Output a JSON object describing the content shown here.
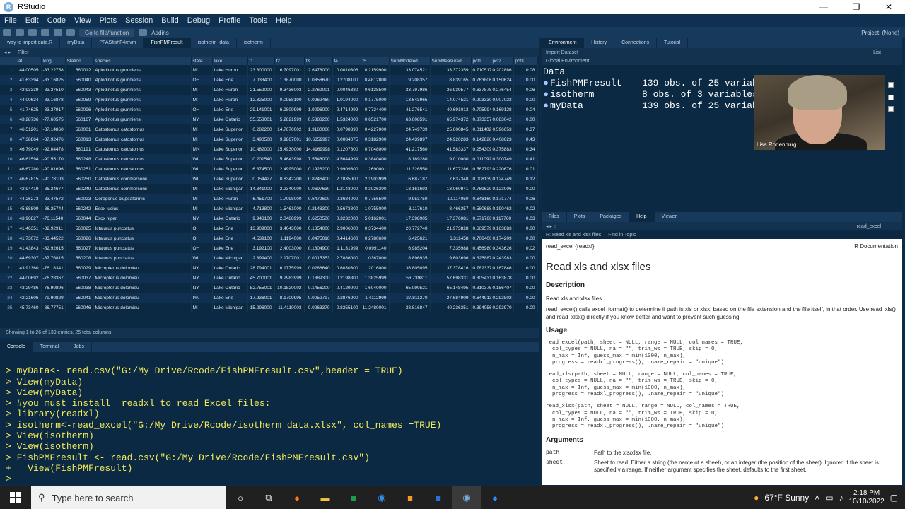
{
  "window": {
    "title": "RStudio",
    "min": "—",
    "max": "❐",
    "close": "✕"
  },
  "menu": [
    "File",
    "Edit",
    "Code",
    "View",
    "Plots",
    "Session",
    "Build",
    "Debug",
    "Profile",
    "Tools",
    "Help"
  ],
  "toolbar": {
    "goto": "Go to file/function",
    "addins": "Addins",
    "project": "Project: (None)"
  },
  "source_tabs": [
    "way to import data.R",
    "myData",
    "PFASfishF4mvm",
    "FishPMFresult",
    "isotherm_data",
    "isotherm"
  ],
  "source_active_tab": "FishPMFresult",
  "filter_label": "Filter",
  "columns": [
    "",
    "lat",
    "long",
    "Station",
    "species",
    "state",
    "lake",
    "f1",
    "f2",
    "f3",
    "f4",
    "f5",
    "SumModeled",
    "SumMeasured",
    "pct1",
    "pct2",
    "pct3"
  ],
  "rows": [
    [
      "1",
      "44.00505",
      "-83.22758",
      "560012",
      "Aplodinotus grunniens",
      "MI",
      "Lake Huron",
      "23.300000",
      "6.7097001",
      "2.6478000",
      "0.0010306",
      "0.2159900",
      "33.074521",
      "33.372359",
      "0.710517",
      "0.202866",
      "0.08"
    ],
    [
      "2",
      "41.63394",
      "-83.16825",
      "560040",
      "Aplodinotus grunniens",
      "OH",
      "Lake Erie",
      "7.033400",
      "1.3870000",
      "0.0358670",
      "0.2708100",
      "0.4812800",
      "9.208357",
      "8.839165",
      "0.763806",
      "0.150624",
      "0.00"
    ],
    [
      "3",
      "43.93339",
      "-83.37510",
      "560043",
      "Aplodinotus grunniens",
      "MI",
      "Lake Huron",
      "21.559000",
      "9.3436003",
      "2.2769001",
      "0.0046380",
      "0.6138500",
      "33.797986",
      "36.939577",
      "0.637878",
      "0.276454",
      "0.06"
    ],
    [
      "4",
      "44.00634",
      "-83.16878",
      "560059",
      "Aplodinotus grunniens",
      "MI",
      "Lake Huron",
      "12.325000",
      "0.0958190",
      "0.0262460",
      "1.0194000",
      "0.1775000",
      "13.643965",
      "14.074521",
      "0.903330",
      "0.007023",
      "0.00"
    ],
    [
      "5",
      "41.74625",
      "-83.37917",
      "560096",
      "Aplodinotus grunniens",
      "OH",
      "Lake Erie",
      "29.141001",
      "6.9809999",
      "1.9096000",
      "2.4714999",
      "0.7734400",
      "41.276541",
      "40.691013",
      "0.705994",
      "0.169128",
      "0.04"
    ],
    [
      "6",
      "43.28736",
      "-77.60575",
      "560167",
      "Aplodinotus grunniens",
      "NY",
      "Lake Ontario",
      "55.553001",
      "5.2821999",
      "0.5888200",
      "1.5324000",
      "0.6521700",
      "63.608591",
      "65.974372",
      "0.873357",
      "0.083042",
      "0.00"
    ],
    [
      "7",
      "46.51201",
      "-87.14860",
      "560001",
      "Catostomus catostomus",
      "MI",
      "Lake Superior",
      "0.282200",
      "14.7670002",
      "1.9180000",
      "0.0798390",
      "0.4227000",
      "24.749739",
      "25.600845",
      "0.011402",
      "0.596653",
      "0.37"
    ],
    [
      "8",
      "47.38864",
      "-87.92476",
      "560013",
      "Catostomus catostomus",
      "MI",
      "Lake Superior",
      "3.490500",
      "9.9867001",
      "10.6359997",
      "0.0084075",
      "0.3182900",
      "24.439897",
      "24.920283",
      "0.142820",
      "0.408623",
      "0.43"
    ],
    [
      "9",
      "46.79049",
      "-92.04478",
      "560191",
      "Catostomus catostomus",
      "MN",
      "Lake Superior",
      "10.482000",
      "15.4930000",
      "14.4169998",
      "0.1207600",
      "0.7048000",
      "41.217560",
      "41.583337",
      "0.254309",
      "0.375883",
      "0.34"
    ],
    [
      "10",
      "46.61594",
      "-90.55170",
      "560248",
      "Catostomus catostomus",
      "WI",
      "Lake Superior",
      "0.201540",
      "5.4643998",
      "7.5548000",
      "4.5644999",
      "0.3840400",
      "18.169280",
      "19.010000",
      "0.011092",
      "0.300749",
      "0.41"
    ],
    [
      "11",
      "46.67280",
      "-90.81696",
      "560251",
      "Catostomus catostomus",
      "WI",
      "Lake Superior",
      "6.374500",
      "2.4995000",
      "0.1926200",
      "0.9909300",
      "1.2690001",
      "11.326550",
      "11.677286",
      "0.562793",
      "0.220676",
      "0.01"
    ],
    [
      "12",
      "46.67815",
      "-90.78103",
      "560250",
      "Catostomus commersonii",
      "WI",
      "Lake Superior",
      "0.054427",
      "0.8342200",
      "0.8246400",
      "2.7835000",
      "2.1903999",
      "6.687187",
      "7.637348",
      "0.008139",
      "0.124749",
      "0.12"
    ],
    [
      "13",
      "42.94419",
      "-86.24677",
      "560249",
      "Catostomus commersonii",
      "MI",
      "Lake Michigan",
      "14.341000",
      "2.2340000",
      "0.0697630",
      "1.2143000",
      "0.3026300",
      "18.161693",
      "18.060941",
      "0.789629",
      "0.123006",
      "0.00"
    ],
    [
      "14",
      "44.26273",
      "-83.47572",
      "560023",
      "Coregonus clupeaformis",
      "MI",
      "Lake Huron",
      "6.451700",
      "1.7098000",
      "0.6479600",
      "0.3684000",
      "0.7756500",
      "9.953750",
      "10.114050",
      "0.648160",
      "0.171774",
      "0.06"
    ],
    [
      "15",
      "45.88809",
      "-86.25744",
      "560242",
      "Esox lucius",
      "MI",
      "Lake Michigan",
      "4.713800",
      "1.5461000",
      "0.2148300",
      "0.5673800",
      "1.0755000",
      "8.117610",
      "8.466257",
      "0.580688",
      "0.190462",
      "0.02"
    ],
    [
      "16",
      "43.96827",
      "-76.11540",
      "560044",
      "Esox niger",
      "NY",
      "Lake Ontario",
      "9.948100",
      "2.0488999",
      "0.6250500",
      "0.3232000",
      "5.0162001",
      "17.398905",
      "17.376081",
      "0.571766",
      "0.117760",
      "0.03"
    ],
    [
      "17",
      "41.46351",
      "-82.92911",
      "560025",
      "Ictalurus punctatus",
      "OH",
      "Lake Erie",
      "13.909000",
      "3.4043000",
      "0.1854000",
      "2.9006000",
      "0.3734400",
      "20.772740",
      "21.973828",
      "0.669579",
      "0.163883",
      "0.00"
    ],
    [
      "18",
      "41.73072",
      "-83.44522",
      "560026",
      "Ictalurus punctatus",
      "OH",
      "Lake Erie",
      "4.539100",
      "1.1194000",
      "0.0475010",
      "0.4414600",
      "0.2780600",
      "6.425621",
      "6.311458",
      "0.706406",
      "0.174209",
      "0.00"
    ],
    [
      "19",
      "41.43843",
      "-82.92615",
      "560027",
      "Ictalurus punctatus",
      "OH",
      "Lake Erie",
      "3.192100",
      "2.4003000",
      "0.1804900",
      "1.1131999",
      "0.0991140",
      "6.985204",
      "7.335988",
      "0.456980",
      "0.343626",
      "0.02"
    ],
    [
      "20",
      "44.69307",
      "-87.76815",
      "560208",
      "Ictalurus punctatus",
      "WI",
      "Lake Michigan",
      "2.899400",
      "2.1707001",
      "0.0015353",
      "2.7886000",
      "1.0367000",
      "8.896935",
      "9.603696",
      "0.325887",
      "0.243983",
      "0.00"
    ],
    [
      "21",
      "43.91360",
      "-76.18341",
      "560029",
      "Micropterus dolomieu",
      "NY",
      "Lake Ontario",
      "28.794001",
      "6.1775999",
      "0.0288640",
      "0.6030300",
      "1.2016000",
      "36.805095",
      "37.378416",
      "0.782337",
      "0.167846",
      "0.00"
    ],
    [
      "22",
      "44.00692",
      "-76.28367",
      "560037",
      "Micropterus dolomieu",
      "NY",
      "Lake Ontario",
      "45.700001",
      "9.2983999",
      "0.1389300",
      "0.2198800",
      "1.3825999",
      "56.739811",
      "57.698331",
      "0.805431",
      "0.163878",
      "0.00"
    ],
    [
      "23",
      "43.29486",
      "-76.90896",
      "560038",
      "Micropterus dolomieu",
      "NY",
      "Lake Ontario",
      "52.755001",
      "10.1820002",
      "0.1456200",
      "0.4129000",
      "1.6040000",
      "65.099521",
      "65.148495",
      "0.810375",
      "0.156407",
      "0.00"
    ],
    [
      "24",
      "42.21606",
      "-79.90829",
      "560041",
      "Micropterus dolomieu",
      "PA",
      "Lake Erie",
      "17.936001",
      "8.1709995",
      "0.0052797",
      "0.2876900",
      "1.4112999",
      "27.811270",
      "27.684909",
      "0.644913",
      "0.293802",
      "0.00"
    ],
    [
      "25",
      "45.73460",
      "-86.77751",
      "560046",
      "Micropterus dolomieu",
      "MI",
      "Lake Michigan",
      "15.296000",
      "11.4110003",
      "0.0263370",
      "0.8355100",
      "11.2480001",
      "38.816847",
      "40.236351",
      "0.394056",
      "0.293970",
      "0.00"
    ]
  ],
  "table_status": "Showing 1 to 26 of 139 entries, 25 total columns",
  "console_tabs": [
    "Console",
    "Terminal",
    "Jobs"
  ],
  "console_lines": [
    "> myData<- read.csv(\"G:/My Drive/Rcode/FishPMFresult.csv\",header = TRUE)",
    "> View(myData)",
    "> View(myData)",
    "> #you must install  readxl to read Excel files:",
    "> library(readxl)",
    "> isotherm<-read_excel(\"G:/My Drive/Rcode/isotherm data.xlsx\", col_names =TRUE)",
    "> View(isotherm)",
    "> View(isotherm)",
    "> FishPMFresult <- read.csv(\"G:/My Drive/Rcode/FishPMFresult.csv\")",
    "+   View(FishPMFresult)",
    "> "
  ],
  "env_tabs": [
    "Environment",
    "History",
    "Connections",
    "Tutorial"
  ],
  "env_import": "Import Dataset",
  "env_list": "List",
  "env_scope": "Global Environment",
  "env_section": "Data",
  "env_items": [
    {
      "name": "FishPMFresult",
      "desc": "139 obs. of 25 variab"
    },
    {
      "name": "isotherm",
      "desc": "8 obs. of 3 variables"
    },
    {
      "name": "myData",
      "desc": "139 obs. of 25 variab"
    }
  ],
  "webcam_name": "Lisa Rodenburg",
  "help_tabs": [
    "Files",
    "Plots",
    "Packages",
    "Help",
    "Viewer"
  ],
  "help_search": "read_excel",
  "help_topic_tab": "R: Read xls and xlsx files",
  "help_find": "Find in Topic",
  "help": {
    "pkg": "read_excel {readxl}",
    "rdoc": "R Documentation",
    "title": "Read xls and xlsx files",
    "desc_h": "Description",
    "desc": "Read xls and xlsx files",
    "desc2": "read_excel() calls excel_format() to determine if path is xls or xlsx, based on the file extension and the file itself, in that order. Use read_xls() and read_xlsx() directly if you know better and want to prevent such guessing.",
    "usage_h": "Usage",
    "usage1": "read_excel(path, sheet = NULL, range = NULL, col_names = TRUE,\n  col_types = NULL, na = \"\", trim_ws = TRUE, skip = 0,\n  n_max = Inf, guess_max = min(1000, n_max),\n  progress = readxl_progress(), .name_repair = \"unique\")",
    "usage2": "read_xls(path, sheet = NULL, range = NULL, col_names = TRUE,\n  col_types = NULL, na = \"\", trim_ws = TRUE, skip = 0,\n  n_max = Inf, guess_max = min(1000, n_max),\n  progress = readxl_progress(), .name_repair = \"unique\")",
    "usage3": "read_xlsx(path, sheet = NULL, range = NULL, col_names = TRUE,\n  col_types = NULL, na = \"\", trim_ws = TRUE, skip = 0,\n  n_max = Inf, guess_max = min(1000, n_max),\n  progress = readxl_progress(), .name_repair = \"unique\")",
    "args_h": "Arguments",
    "arg1_n": "path",
    "arg1_d": "Path to the xls/xlsx file.",
    "arg2_n": "sheet",
    "arg2_d": "Sheet to read. Either a string (the name of a sheet), or an integer (the position of the sheet). Ignored if the sheet is specified via range. If neither argument specifies the sheet, defaults to the first sheet."
  },
  "taskbar": {
    "search_placeholder": "Type here to search",
    "weather": "67°F  Sunny",
    "time": "2:18 PM",
    "date": "10/10/2022"
  }
}
